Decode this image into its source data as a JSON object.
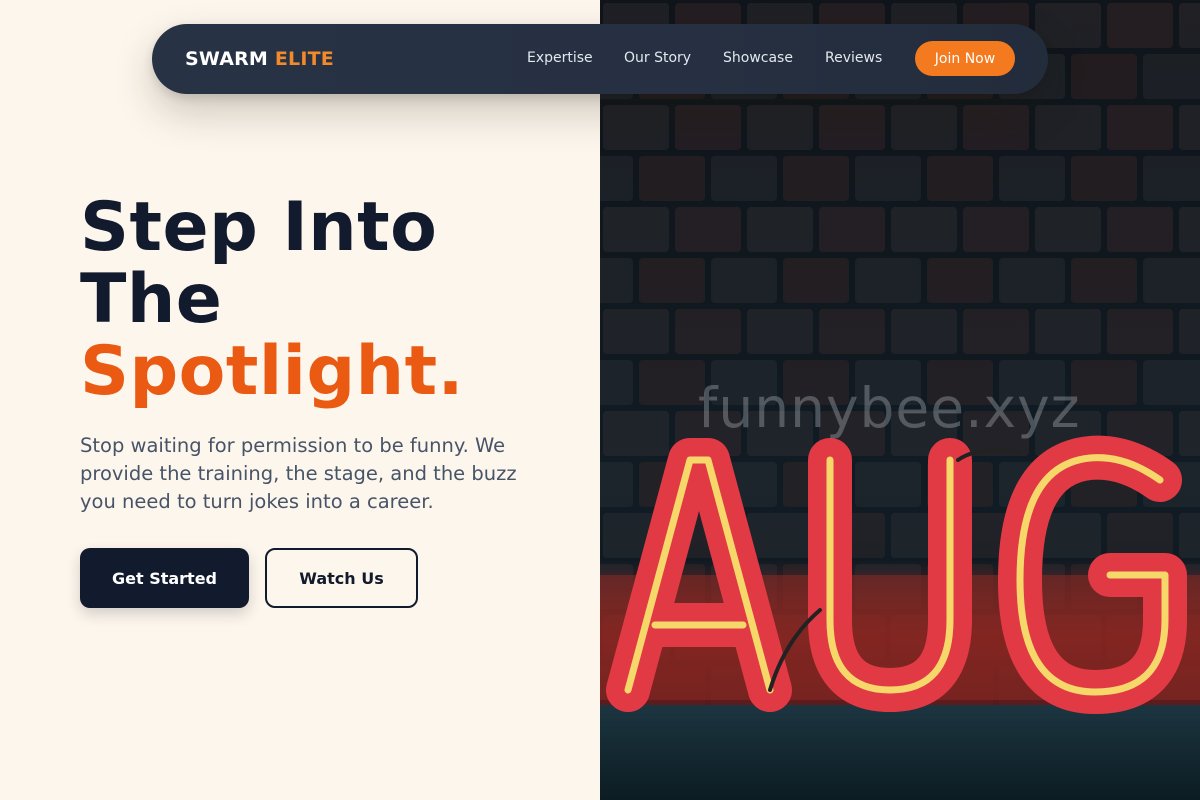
{
  "brand": {
    "name": "SWARM",
    "accent": "ELITE"
  },
  "nav": {
    "links": [
      "Expertise",
      "Our Story",
      "Showcase",
      "Reviews"
    ],
    "cta_label": "Join Now"
  },
  "hero": {
    "title_line1": "Step Into",
    "title_line2": "The",
    "title_accent": "Spotlight.",
    "subtitle": "Stop waiting for permission to be funny. We provide the training, the stage, and the buzz you need to turn jokes into a career.",
    "primary_label": "Get Started",
    "secondary_label": "Watch Us"
  },
  "image": {
    "watermark": "funnybee.xyz",
    "sign_text": "AUG",
    "icon": "neon-sign-photo"
  },
  "colors": {
    "background": "#fdf6ec",
    "navbar": "#263042",
    "accent_orange": "#f47a1f",
    "title_accent": "#ea5a12",
    "dark_text": "#121a2e",
    "body_text": "#475468"
  }
}
